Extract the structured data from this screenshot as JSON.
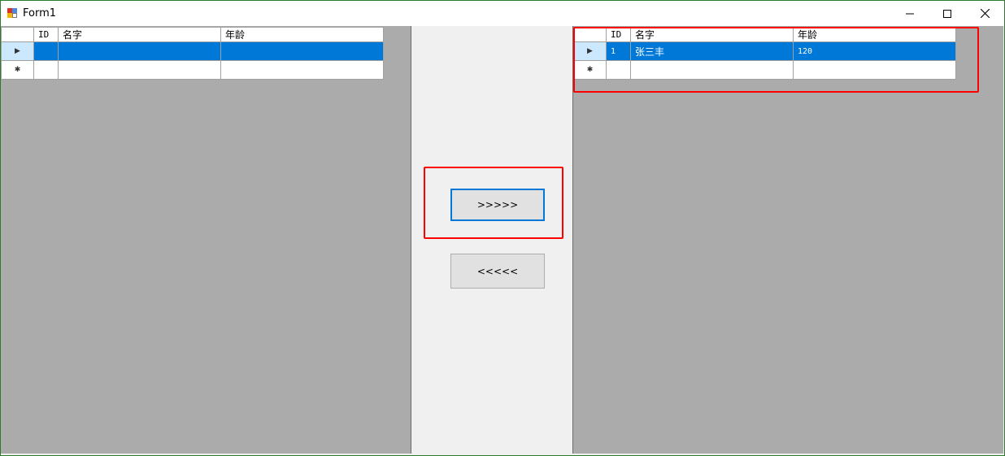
{
  "window": {
    "title": "Form1",
    "buttons": {
      "minimize": "—",
      "maximize": "☐",
      "close": "✕"
    }
  },
  "left_grid": {
    "columns": [
      "ID",
      "名字",
      "年龄"
    ],
    "rows": [
      {
        "id": "",
        "name": "",
        "age": "",
        "selected": true
      },
      {
        "id": "",
        "name": "",
        "age": "",
        "new_row": true
      }
    ]
  },
  "right_grid": {
    "columns": [
      "ID",
      "名字",
      "年龄"
    ],
    "rows": [
      {
        "id": "1",
        "name": "张三丰",
        "age": "120",
        "selected": true
      },
      {
        "id": "",
        "name": "",
        "age": "",
        "new_row": true
      }
    ]
  },
  "actions": {
    "move_right_label": ">>>>>",
    "move_left_label": "<<<<<"
  },
  "glyphs": {
    "current_row": "▶",
    "new_row": "✱"
  },
  "colors": {
    "selection": "#0078d7",
    "grid_background": "#ababab",
    "annotation": "#ff0000"
  }
}
